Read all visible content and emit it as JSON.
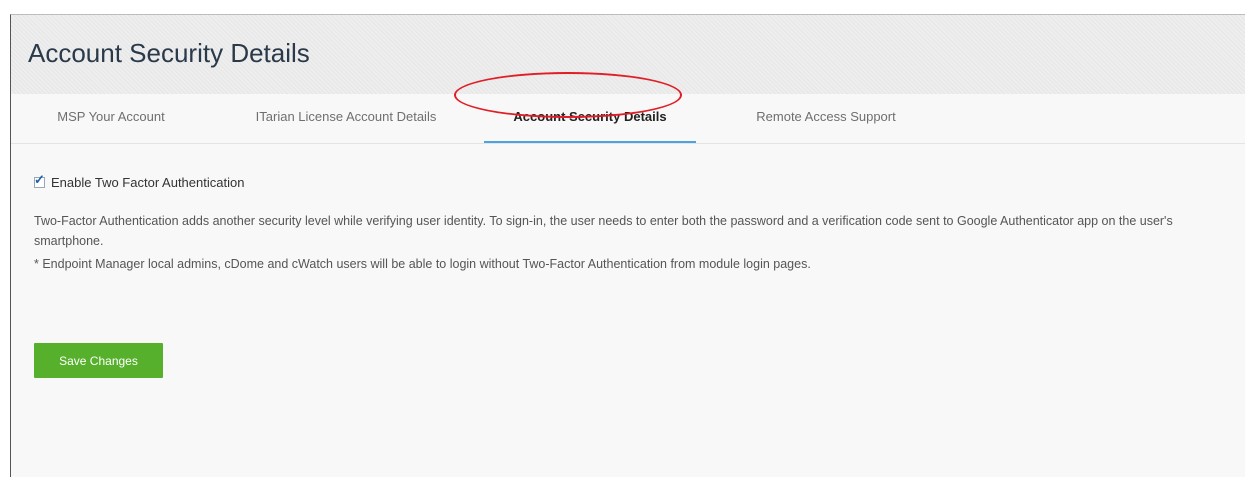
{
  "page": {
    "title": "Account Security Details"
  },
  "tabs": [
    {
      "label": "MSP Your Account",
      "active": false
    },
    {
      "label": "ITarian License Account Details",
      "active": false
    },
    {
      "label": "Account Security Details",
      "active": true
    },
    {
      "label": "Remote Access Support",
      "active": false
    }
  ],
  "two_factor": {
    "checkbox_label": "Enable Two Factor Authentication",
    "checked": true,
    "description": "Two-Factor Authentication adds another security level while verifying user identity. To sign-in, the user needs to enter both the password and a verification code sent to Google Authenticator app on the user's smartphone.",
    "note": "* Endpoint Manager local admins, cDome and cWatch users will be able to login without Two-Factor Authentication from module login pages."
  },
  "actions": {
    "save_label": "Save Changes"
  },
  "colors": {
    "accent_tab_underline": "#4da3e0",
    "save_button": "#56b02c",
    "highlight_ring": "#e11d25"
  }
}
